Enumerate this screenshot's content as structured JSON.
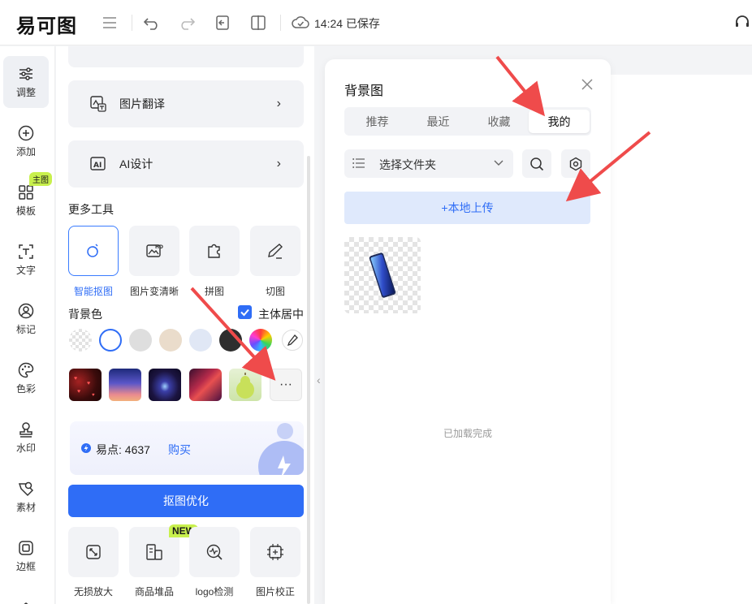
{
  "header": {
    "logo": "易可图",
    "save_time": "14:24 已保存"
  },
  "rail": {
    "items": [
      {
        "label": "调整",
        "icon": "sliders-icon"
      },
      {
        "label": "添加",
        "icon": "plus-circle-icon"
      },
      {
        "label": "模板",
        "icon": "grid-icon"
      },
      {
        "label": "文字",
        "icon": "text-icon"
      },
      {
        "label": "标记",
        "icon": "person-mark-icon"
      },
      {
        "label": "色彩",
        "icon": "palette-icon"
      },
      {
        "label": "水印",
        "icon": "stamp-icon"
      },
      {
        "label": "素材",
        "icon": "material-icon"
      },
      {
        "label": "边框",
        "icon": "frame-icon"
      }
    ],
    "template_badge": "主图"
  },
  "panel": {
    "cards": [
      {
        "label": "图片翻译",
        "icon": "image-translate-icon"
      },
      {
        "label": "AI设计",
        "icon": "ai-icon"
      }
    ],
    "more_tools_title": "更多工具",
    "tools": [
      {
        "label": "智能抠图",
        "icon": "smart-cutout-icon"
      },
      {
        "label": "图片变清晰",
        "icon": "hd-image-icon"
      },
      {
        "label": "拼图",
        "icon": "puzzle-icon"
      },
      {
        "label": "切图",
        "icon": "knife-icon"
      }
    ],
    "bg_color_title": "背景色",
    "center_subject_label": "主体居中",
    "center_subject_checked": true,
    "colors": [
      "transparent",
      "#ffffff",
      "#dedede",
      "#eadccb",
      "#e0e7f5",
      "#2e2e2e",
      "rainbow"
    ],
    "points_label": "易点: 4637",
    "buy_label": "购买",
    "optimize_button": "抠图优化",
    "new_badge": "NEW",
    "bottom_tools": [
      {
        "label": "无损放大",
        "icon": "enlarge-icon"
      },
      {
        "label": "商品堆品",
        "icon": "stack-icon"
      },
      {
        "label": "logo检测",
        "icon": "logo-detect-icon"
      },
      {
        "label": "图片校正",
        "icon": "correct-icon"
      }
    ]
  },
  "bg_panel": {
    "title": "背景图",
    "tabs": [
      "推荐",
      "最近",
      "收藏",
      "我的"
    ],
    "active_tab": "我的",
    "folder_placeholder": "选择文件夹",
    "upload_label": "+本地上传",
    "loaded_text": "已加载完成"
  },
  "colors": {
    "accent": "#2f6df6",
    "badge": "#c8f04d",
    "arrow": "#ef4b4b"
  }
}
